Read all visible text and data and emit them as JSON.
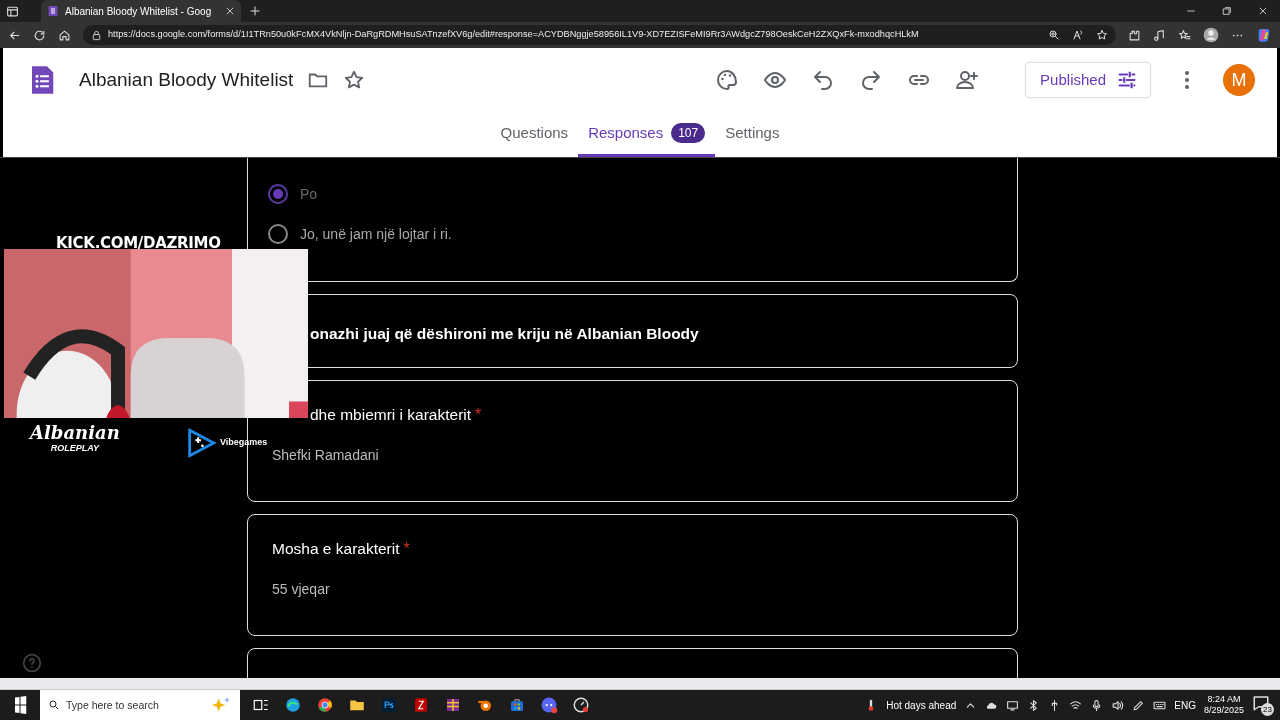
{
  "browser": {
    "tab_title": "Albanian Bloody Whitelist - Goog",
    "url": "https://docs.google.com/forms/d/1I1TRn50u0kFcMX4VkNljn-DaRgRDMHsuSATnzefXV6g/edit#response=ACYDBNggje58956IL1V9-XD7EZISFeMI9Rr3AWdgcZ798OeskCeH2ZXQxFk-mxodhqcHLkM"
  },
  "form": {
    "title": "Albanian Bloody Whitelist",
    "publish_button": "Published",
    "avatar_letter": "M"
  },
  "tabs": [
    {
      "label": "Questions",
      "selected": false
    },
    {
      "label": "Responses",
      "selected": true,
      "count": "107"
    },
    {
      "label": "Settings",
      "selected": false
    }
  ],
  "cards": [
    {
      "kind": "choice",
      "options": [
        {
          "label": "Po",
          "selected": true
        },
        {
          "label": "Jo, unë jam një lojtar i ri.",
          "selected": false
        }
      ]
    },
    {
      "kind": "section",
      "title": "onazhi juaj që dëshironi me kriju në Albanian Bloody",
      "clipped_by_overlay": true
    },
    {
      "kind": "answer",
      "title": "dhe mbiemri i karakterit",
      "required_mark": "*",
      "answer": "Shefki Ramadani",
      "clipped_by_overlay": true
    },
    {
      "kind": "answer",
      "title": "Mosha e karakterit",
      "required_mark": "*",
      "answer": "55 vjeqar",
      "clipped_by_overlay": false
    },
    {
      "kind": "cut"
    }
  ],
  "stream_overlay": {
    "channel": "KICK.COM/DAZRIMO",
    "logo_script": "Albanian",
    "logo_sub": "ROLEPLAY",
    "sponsor": "Vibegames"
  },
  "taskbar": {
    "search_placeholder": "Type here to search",
    "weather": "Hot days ahead",
    "language": "ENG",
    "time": "8:24 AM",
    "date": "8/29/2025",
    "notifications": "23"
  }
}
